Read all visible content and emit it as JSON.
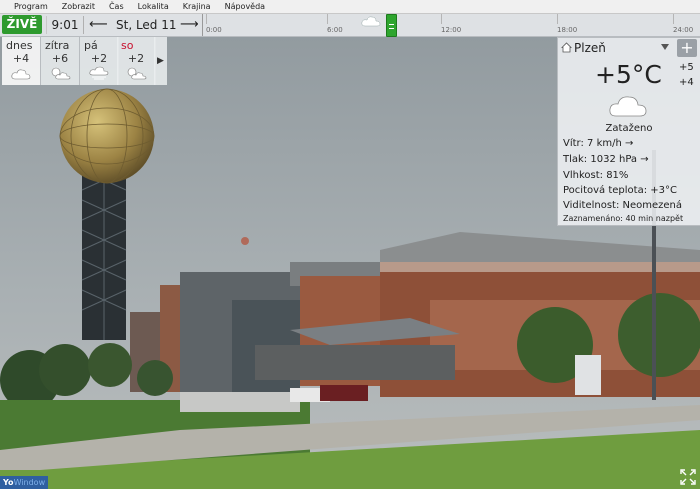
{
  "menu": [
    "Program",
    "Zobrazit",
    "Čas",
    "Lokalita",
    "Krajina",
    "Nápověda"
  ],
  "toolbar": {
    "live_label": "ŽIVĚ",
    "time": "9:01",
    "prev_arrow": "⟵",
    "date": "St, Led 11",
    "next_arrow": "⟶"
  },
  "timeline": {
    "ticks": [
      "0:00",
      "6:00",
      "12:00",
      "18:00",
      "24:00"
    ],
    "position_hours": 9.02,
    "weather_icon": "cloud-icon"
  },
  "forecast": [
    {
      "day": "dnes",
      "temp": "+4",
      "icon": "cloud-icon"
    },
    {
      "day": "zítra",
      "temp": "+6",
      "icon": "sun-cloud-icon"
    },
    {
      "day": "pá",
      "temp": "+2",
      "icon": "cloud-fog-icon"
    },
    {
      "day": "so",
      "temp": "+2",
      "icon": "sun-cloud-icon"
    }
  ],
  "forecast_next": "▶",
  "panel": {
    "city": "Plzeň",
    "plus_label": "+",
    "temp": "+5°C",
    "hi": "+5",
    "lo": "+4",
    "condition": "Zataženo",
    "wind": "Vítr:  7 km/h  →",
    "pressure": "Tlak:  1032 hPa  →",
    "humidity": "Vlhkost:  81%",
    "feels": "Pocitová teplota:  +3°C",
    "visibility": "Viditelnost:  Neomezená",
    "recorded": "Zaznamenáno:  40 min nazpět"
  },
  "logo": {
    "a": "Yo",
    "b": "Window"
  },
  "colors": {
    "live": "#2e9a2e",
    "weekend": "#c8102e",
    "logo": "#2f5fa0"
  }
}
